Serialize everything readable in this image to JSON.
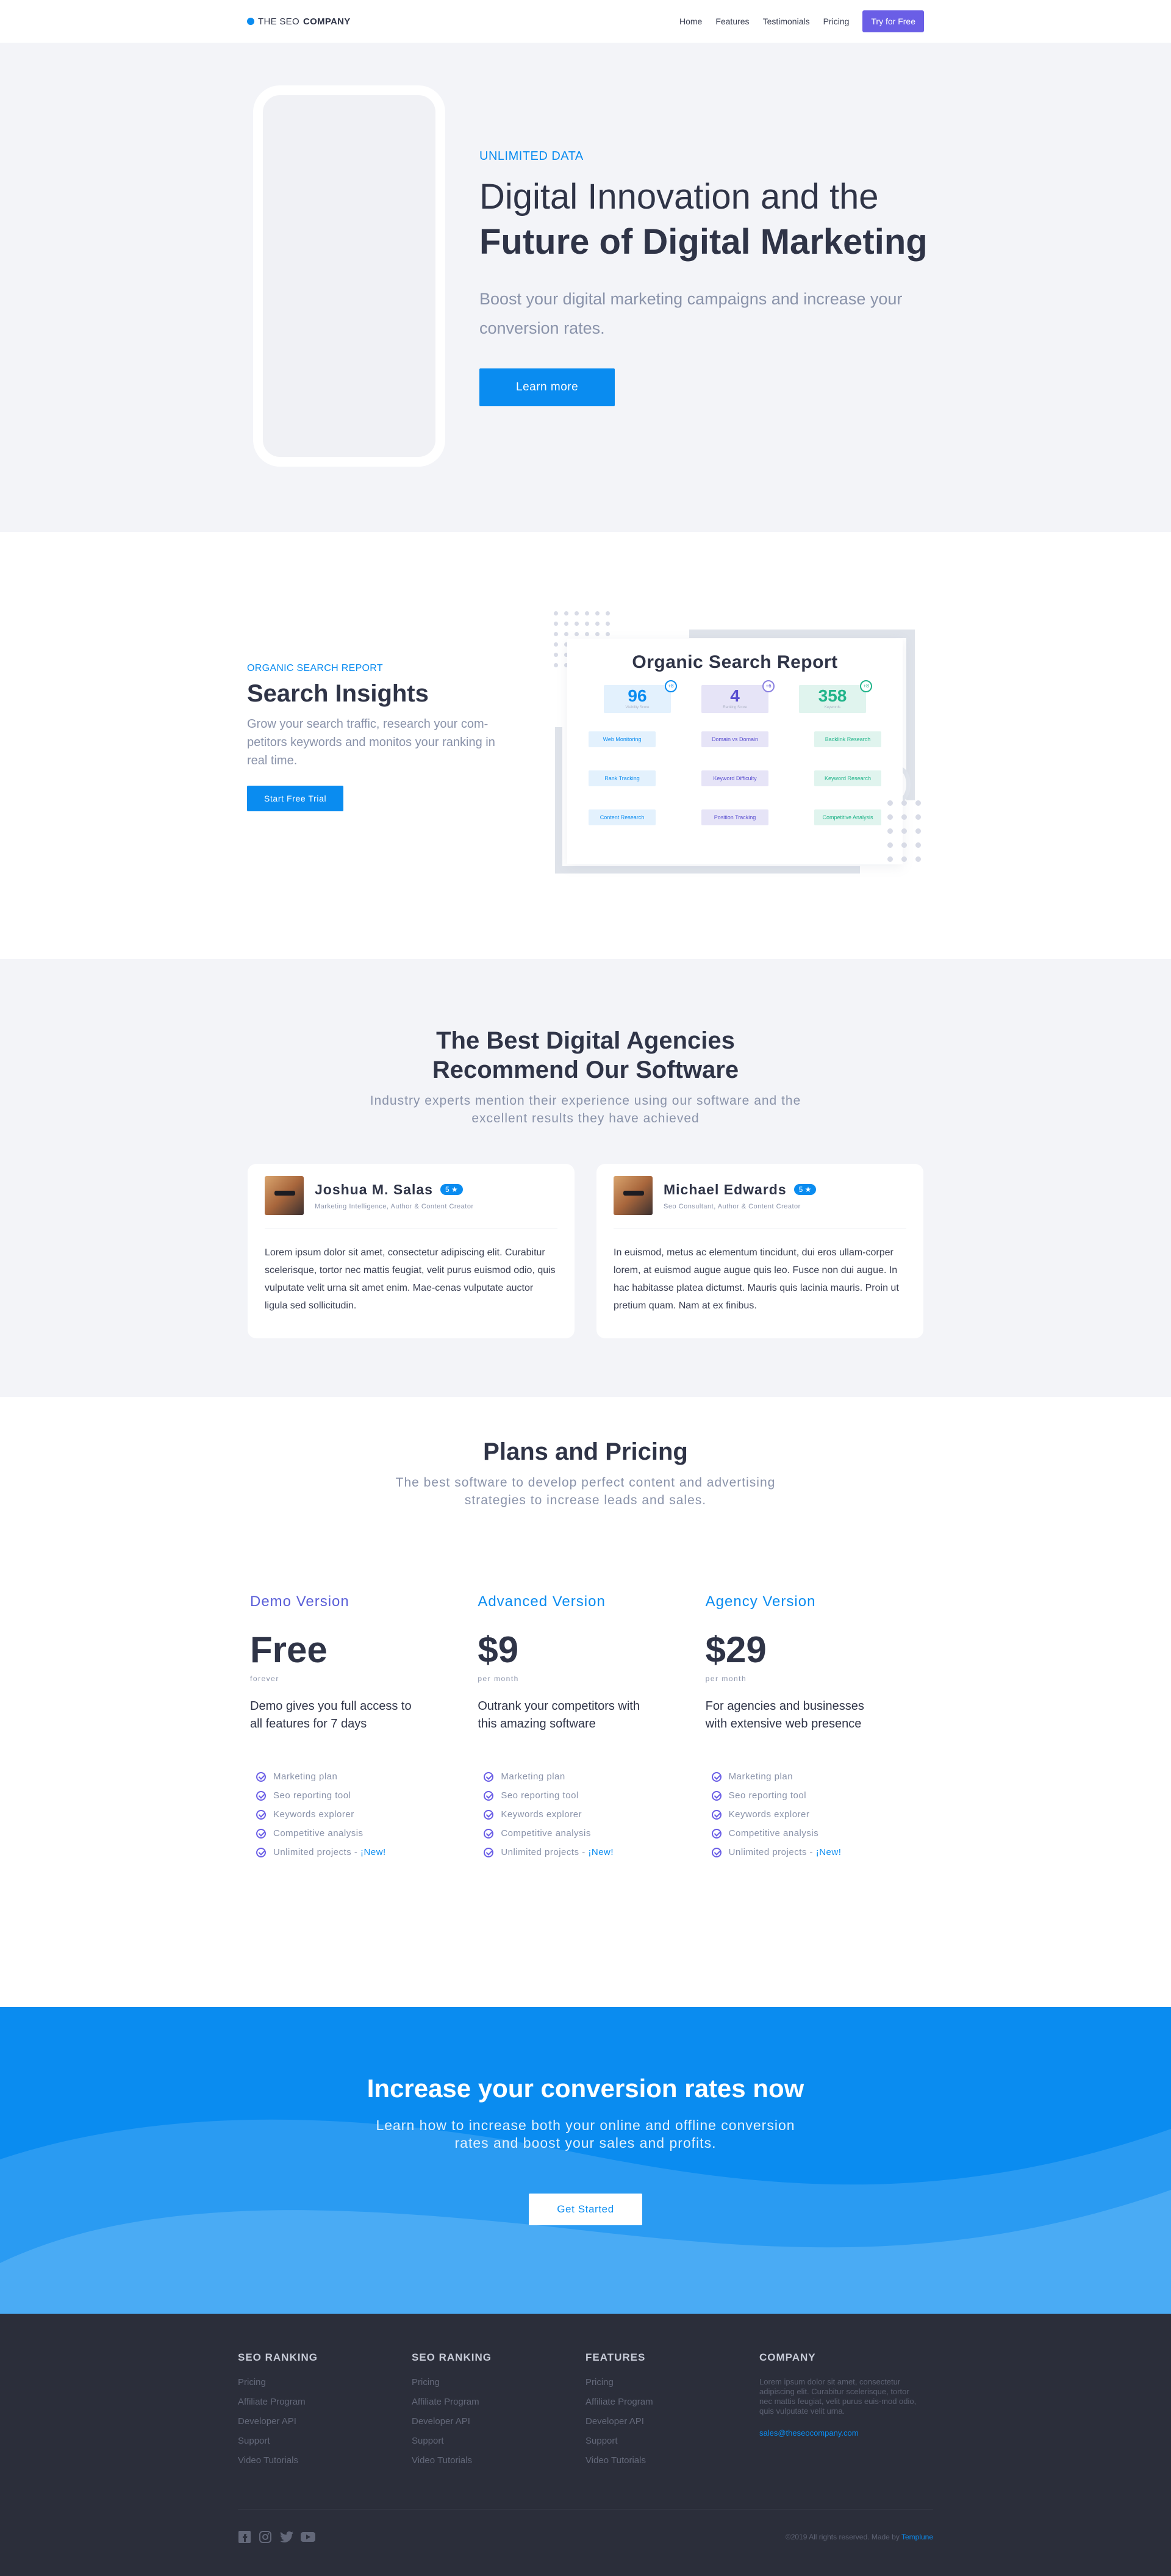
{
  "nav": {
    "logo_prefix": "THE SEO",
    "logo_bold": "COMPANY",
    "items": [
      "Home",
      "Features",
      "Testimonials",
      "Pricing"
    ],
    "cta": "Try for Free"
  },
  "hero": {
    "eyebrow": "UNLIMITED DATA",
    "title_line1": "Digital Innovation and the",
    "title_line2": "Future of Digital Marketing",
    "subtitle": "Boost your digital marketing campaigns and increase your conversion rates.",
    "button": "Learn more"
  },
  "insights": {
    "eyebrow": "ORGANIC SEARCH REPORT",
    "title": "Search Insights",
    "text": "Grow your search traffic, research your com-petitors keywords and monitos your ranking in real time.",
    "button": "Start Free Trial",
    "report": {
      "title": "Organic Search Report",
      "stats": [
        {
          "value": "96",
          "label": "Visibility Score",
          "badge": "+8"
        },
        {
          "value": "4",
          "label": "Ranking Score",
          "badge": "+6"
        },
        {
          "value": "358",
          "label": "Keywords",
          "badge": "+8"
        }
      ],
      "features": [
        "Web Monitoring",
        "Domain vs Domain",
        "Backlink Research",
        "Rank Tracking",
        "Keyword Difficulty",
        "Keyword Research",
        "Content Research",
        "Position Tracking",
        "Competitive Analysis"
      ]
    }
  },
  "testimonials": {
    "title_line1": "The Best Digital Agencies",
    "title_line2": "Recommend Our Software",
    "subtitle": "Industry experts mention their experience using our software and the excellent results they have achieved",
    "cards": [
      {
        "name": "Joshua M. Salas",
        "rating": "5 ★",
        "role": "Marketing Intelligence, Author & Content Creator",
        "text": "Lorem ipsum dolor sit amet, consectetur adipiscing elit. Curabitur scelerisque, tortor nec mattis feugiat, velit purus euismod odio, quis vulputate velit urna sit amet enim. Mae-cenas vulputate auctor ligula sed sollicitudin."
      },
      {
        "name": "Michael Edwards",
        "rating": "5 ★",
        "role": "Seo Consultant, Author & Content Creator",
        "text": "In euismod, metus ac elementum tincidunt, dui eros ullam-corper lorem, at euismod augue augue quis leo. Fusce non dui augue. In hac habitasse platea dictumst. Mauris quis lacinia mauris. Proin ut pretium quam. Nam at ex finibus."
      }
    ]
  },
  "pricing": {
    "title": "Plans and Pricing",
    "subtitle": "The best software to develop perfect content and advertising strategies to increase leads and sales.",
    "plans": [
      {
        "name": "Demo Version",
        "price": "Free",
        "period": "forever",
        "desc": "Demo gives you full access to all features for 7 days"
      },
      {
        "name": "Advanced Version",
        "price": "$9",
        "period": "per month",
        "desc": "Outrank your competitors with this amazing software"
      },
      {
        "name": "Agency Version",
        "price": "$29",
        "period": "per month",
        "desc": "For agencies and businesses with extensive web presence"
      }
    ],
    "features": [
      "Marketing plan",
      "Seo reporting tool",
      "Keywords explorer",
      "Competitive analysis",
      "Unlimited projects - "
    ],
    "new_label": "¡New!"
  },
  "cta": {
    "title": "Increase your conversion rates now",
    "text": "Learn how to increase both your online and offline conversion rates and boost your sales and profits.",
    "button": "Get Started",
    "colors": {
      "base": "#0a8cf0",
      "wave1": "#2a9bf2",
      "wave2": "#4aabf4"
    }
  },
  "footer": {
    "columns": [
      {
        "title": "SEO RANKING",
        "items": [
          "Pricing",
          "Affiliate Program",
          "Developer API",
          "Support",
          "Video Tutorials"
        ]
      },
      {
        "title": "SEO RANKING",
        "items": [
          "Pricing",
          "Affiliate Program",
          "Developer API",
          "Support",
          "Video Tutorials"
        ]
      },
      {
        "title": "FEATURES",
        "items": [
          "Pricing",
          "Affiliate Program",
          "Developer API",
          "Support",
          "Video Tutorials"
        ]
      }
    ],
    "company": {
      "title": "COMPANY",
      "text": "Lorem ipsum dolor sit amet, consectetur adipiscing elit. Curabitur scelerisque, tortor nec mattis feugiat, velit purus euis-mod odio, quis vulputate velit urna.",
      "email": "sales@theseocompany.com"
    },
    "socials": [
      "facebook-icon",
      "instagram-icon",
      "twitter-icon",
      "youtube-icon"
    ],
    "copyright": "©2019 All rights reserved. Made by ",
    "made_by": "Templune"
  }
}
